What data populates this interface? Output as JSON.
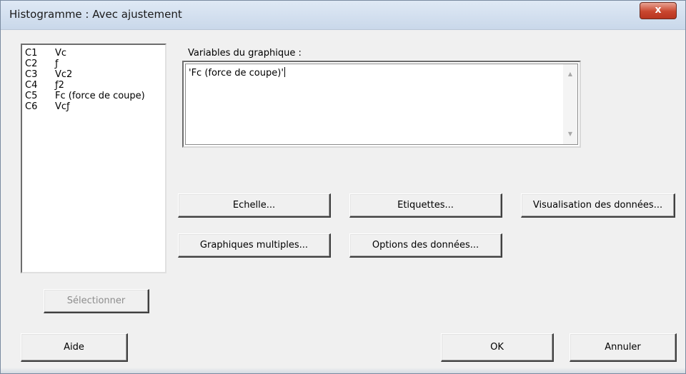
{
  "window": {
    "title": "Histogramme : Avec ajustement",
    "close_glyph": "x"
  },
  "columns": [
    {
      "id": "C1",
      "name": "Vc"
    },
    {
      "id": "C2",
      "name": "ƒ"
    },
    {
      "id": "C3",
      "name": "Vc2"
    },
    {
      "id": "C4",
      "name": "ƒ2"
    },
    {
      "id": "C5",
      "name": "Fc (force de coupe)"
    },
    {
      "id": "C6",
      "name": "Vcƒ"
    }
  ],
  "variables": {
    "label": "Variables du graphique :",
    "value": "'Fc (force de coupe)'"
  },
  "scrollbar": {
    "up_icon": "▲",
    "down_icon": "▼"
  },
  "buttons": {
    "echelle": "Echelle...",
    "etiquettes": "Etiquettes...",
    "visualisation": "Visualisation des données...",
    "graphiques_multiples": "Graphiques multiples...",
    "options_donnees": "Options des données...",
    "selectionner": "Sélectionner",
    "aide": "Aide",
    "ok": "OK",
    "annuler": "Annuler"
  },
  "colors": {
    "dialog_bg": "#f0f0f0",
    "close_button": "#c9462e"
  }
}
